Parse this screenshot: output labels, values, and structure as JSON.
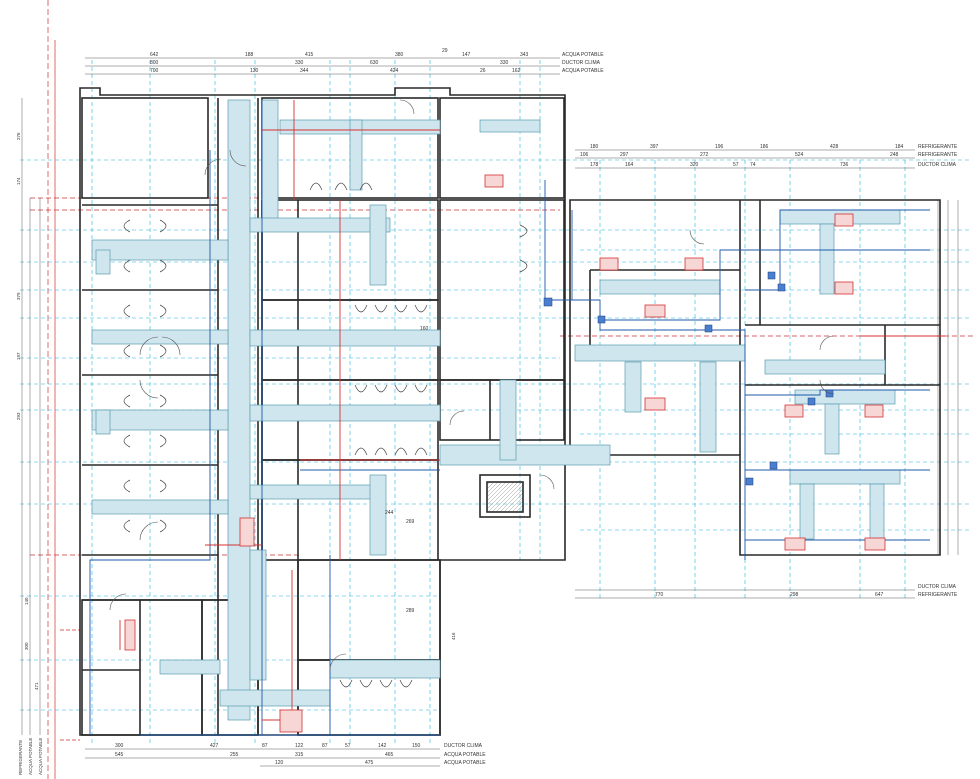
{
  "drawing": {
    "colors": {
      "wall": "#2a2a2a",
      "duct_fill": "#cfe6ee",
      "duct_stroke": "#5a9bb0",
      "pipe_blue": "#1e5aa8",
      "pipe_cyan": "#22b6e0",
      "pipe_red": "#d43030",
      "diffuser_red": "#e26b6b",
      "dim": "#333333"
    },
    "top_dims": {
      "row1": [
        "642",
        "188",
        "415",
        "380",
        "29",
        "147",
        "343"
      ],
      "row2": [
        "800",
        "330",
        "630",
        "330"
      ],
      "row3": [
        "700",
        "130",
        "344",
        "424",
        "26",
        "162"
      ]
    },
    "top_labels": [
      "ACQUA POTABLE",
      "DUCTOR CLIMA",
      "ACQUA POTABLE"
    ],
    "right_dims": {
      "row1": [
        "180",
        "397",
        "196",
        "186",
        "428",
        "184"
      ],
      "row2": [
        "106",
        "297",
        "272",
        "524",
        "248"
      ],
      "row3": [
        "178",
        "164",
        "320",
        "57",
        "74",
        "736"
      ]
    },
    "right_labels": [
      "REFRIGERANTE",
      "REFRIGERANTE",
      "DUCTOR CLIMA"
    ],
    "bottom_right_dims": [
      "770",
      "298",
      "647"
    ],
    "bottom_right_labels": [
      "DUCTOR CLIMA",
      "REFRIGERANTE"
    ],
    "bottom_dims": {
      "row1": [
        "300",
        "427",
        "87",
        "122",
        "87",
        "57",
        "142",
        "150"
      ],
      "row2": [
        "545",
        "255",
        "315",
        "465"
      ],
      "row3": [
        "120",
        "475"
      ]
    },
    "bottom_labels": [
      "DUCTOR CLIMA",
      "ACQUA POTABLE",
      "ACQUA POTABLE"
    ],
    "left_dims": [
      "276",
      "174",
      "379",
      "197",
      "293",
      "300",
      "140",
      "471"
    ],
    "left_labels": [
      "REFRIGERANTE",
      "ACQUA POTABLE",
      "ACQUA POTABLE"
    ],
    "inner_dims": [
      "244",
      "269",
      "289",
      "416",
      "160"
    ]
  }
}
